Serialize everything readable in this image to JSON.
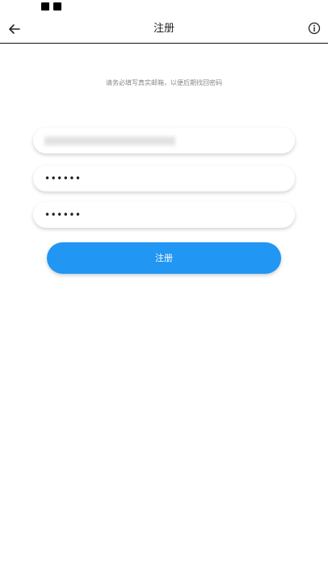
{
  "app_bar": {
    "title": "注册",
    "back_icon": "arrow-left-icon",
    "info_icon": "info-circle-icon"
  },
  "form": {
    "hint": "请务必填写真实邮箱，以便后期找回密码",
    "email_value": "",
    "password_value": "••••••",
    "confirm_password_value": "••••••",
    "submit_label": "注册"
  },
  "colors": {
    "accent": "#2196f3",
    "background": "#ffffff"
  }
}
